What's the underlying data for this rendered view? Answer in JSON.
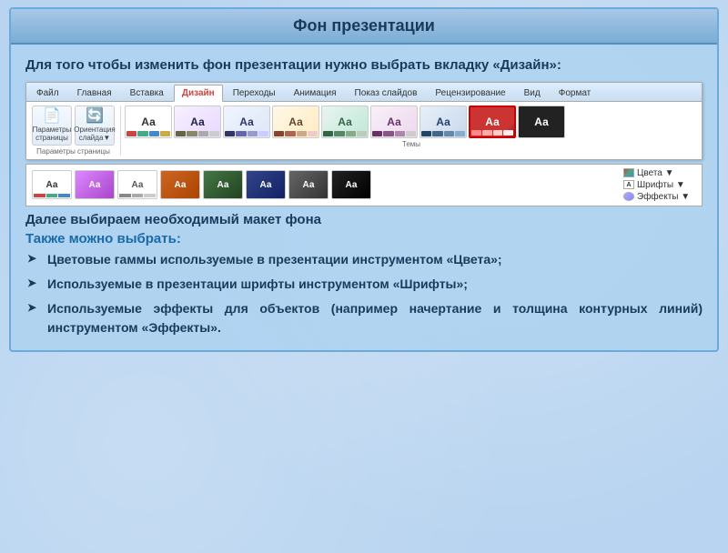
{
  "title": "Фон презентации",
  "intro": "Для того чтобы изменить фон презентации нужно выбрать вкладку «Дизайн»:",
  "ribbon": {
    "tabs": [
      "Файл",
      "Главная",
      "Вставка",
      "Дизайн",
      "Переходы",
      "Анимация",
      "Показ слайдов",
      "Рецензирование",
      "Вид",
      "Формат"
    ],
    "active_tab": "Дизайн",
    "groups": [
      {
        "label": "Параметры страницы",
        "icons": [
          "Параметры страницы",
          "Ориентация слайда▼"
        ]
      }
    ],
    "theme_section_label": "Темы",
    "themes": [
      "Аа",
      "Аа",
      "Аа",
      "Аа",
      "Аа",
      "Аа",
      "Аа",
      "Аа",
      "Аа"
    ]
  },
  "second_ribbon": {
    "themes": [
      "Аа",
      "Аа",
      "Аа",
      "Аа",
      "Аа",
      "Аа",
      "Аа",
      "Аа"
    ],
    "panel_items": [
      "Цвета▼",
      "Шрифты▼",
      "Эффекты▼"
    ]
  },
  "further_text": "Далее выбираем необходимый макет фона",
  "also_label": "Также можно выбрать:",
  "bullets": [
    "Цветовые  гаммы  используемые  в  презентации инструментом «Цвета»;",
    "Используемые  в  презентации  шрифты  инструментом «Шрифты»;",
    "Используемые  эффекты  для  объектов  (например начертание и толщина контурных линий) инструментом «Эффекты»."
  ]
}
